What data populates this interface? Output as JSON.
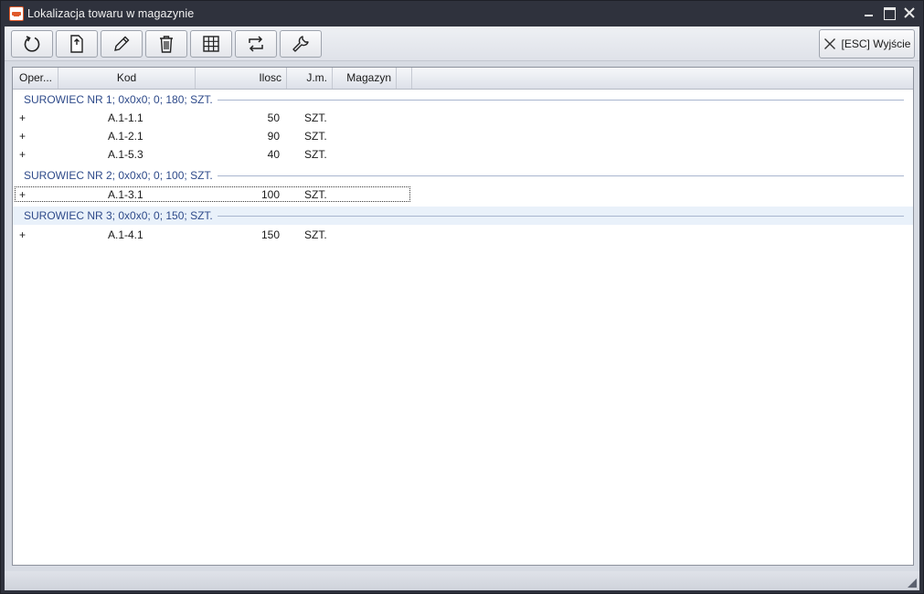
{
  "window": {
    "title": "Lokalizacja towaru w magazynie"
  },
  "toolbar": {
    "buttons": [
      {
        "id": "refresh",
        "icon": "refresh-icon"
      },
      {
        "id": "new",
        "icon": "new-document-icon"
      },
      {
        "id": "edit",
        "icon": "pencil-icon"
      },
      {
        "id": "delete",
        "icon": "trash-icon"
      },
      {
        "id": "grid",
        "icon": "grid-icon"
      },
      {
        "id": "transfer",
        "icon": "swap-arrows-icon"
      },
      {
        "id": "settings",
        "icon": "wrench-icon"
      }
    ],
    "exit_label": "[ESC] Wyjście"
  },
  "grid": {
    "columns": [
      "Oper...",
      "Kod",
      "Ilosc",
      "J.m.",
      "Magazyn"
    ],
    "groups": [
      {
        "label": "SUROWIEC NR 1; 0x0x0; 0; 180; SZT.",
        "rows": [
          {
            "oper": "+",
            "kod": "A.1-1.1",
            "ilosc": "50",
            "jm": "SZT.",
            "magazyn": ""
          },
          {
            "oper": "+",
            "kod": "A.1-2.1",
            "ilosc": "90",
            "jm": "SZT.",
            "magazyn": ""
          },
          {
            "oper": "+",
            "kod": "A.1-5.3",
            "ilosc": "40",
            "jm": "SZT.",
            "magazyn": ""
          }
        ]
      },
      {
        "label": "SUROWIEC NR 2; 0x0x0; 0; 100; SZT.",
        "rows": [
          {
            "oper": "+",
            "kod": "A.1-3.1",
            "ilosc": "100",
            "jm": "SZT.",
            "magazyn": ""
          }
        ]
      },
      {
        "label": "SUROWIEC NR 3; 0x0x0; 0; 150; SZT.",
        "rows": [
          {
            "oper": "+",
            "kod": "A.1-4.1",
            "ilosc": "150",
            "jm": "SZT.",
            "magazyn": ""
          }
        ]
      }
    ]
  },
  "colors": {
    "titlebar": "#2f323d",
    "group_text": "#2e4a8a",
    "group_highlight": "#e9f1fa",
    "grid_background": "#ffffff"
  }
}
